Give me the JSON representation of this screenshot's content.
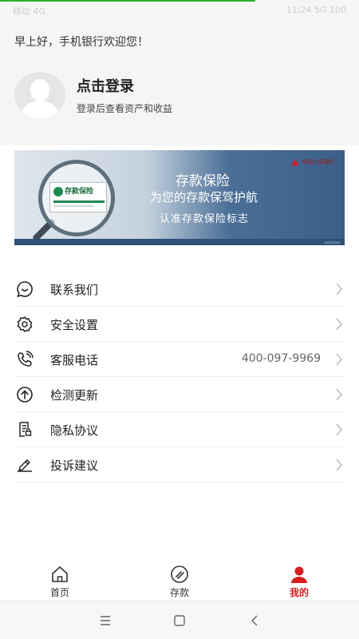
{
  "status_bar": {
    "carrier": "移动 4G",
    "right": "11:24 5G 100"
  },
  "header": {
    "greeting": "早上好，手机银行欢迎您！",
    "login_title": "点击登录",
    "login_subtitle": "登录后查看资产和收益"
  },
  "banner": {
    "card_label": "存款保险",
    "title": "存款保险",
    "line1": "为您的存款保驾护航",
    "line2": "认准存款保险标志",
    "bank_name": "中国人民银行"
  },
  "menu": [
    {
      "label": "联系我们",
      "value": "",
      "icon": "chat-bubble-icon"
    },
    {
      "label": "安全设置",
      "value": "",
      "icon": "gear-icon"
    },
    {
      "label": "客服电话",
      "value": "400-097-9969",
      "icon": "phone-icon"
    },
    {
      "label": "检测更新",
      "value": "",
      "icon": "upload-circle-icon"
    },
    {
      "label": "隐私协议",
      "value": "",
      "icon": "document-lock-icon"
    },
    {
      "label": "投诉建议",
      "value": "",
      "icon": "edit-icon"
    }
  ],
  "tabbar": [
    {
      "label": "首页",
      "icon": "home-icon",
      "active": false
    },
    {
      "label": "存款",
      "icon": "deposit-icon",
      "active": false
    },
    {
      "label": "我的",
      "icon": "user-icon",
      "active": true
    }
  ],
  "colors": {
    "accent": "#d71f1f",
    "banner_blue": "#3a5f88",
    "load_green": "#27b427"
  }
}
